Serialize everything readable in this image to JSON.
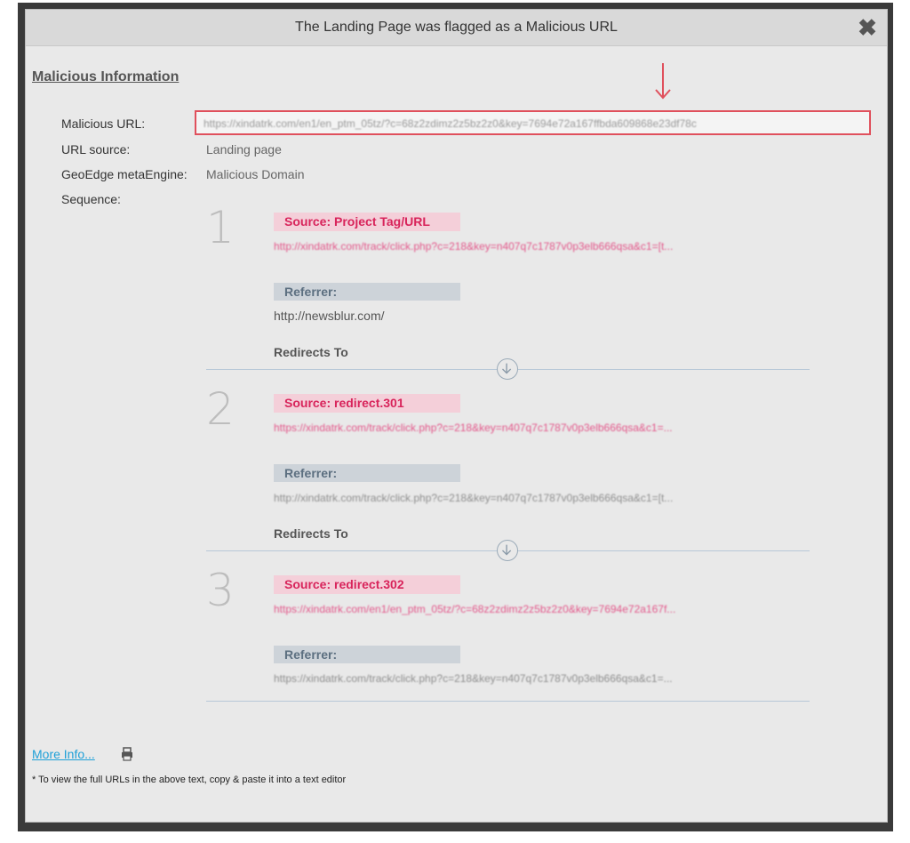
{
  "dialog": {
    "title": "The Landing Page was flagged as a Malicious URL",
    "close_icon": "close-x-icon"
  },
  "section": {
    "title": "Malicious Information"
  },
  "fields": {
    "malicious_url_label": "Malicious URL:",
    "malicious_url_value": "https://xindatrk.com/en1/en_ptm_05tz/?c=68z2zdimz2z5bz2z0&key=7694e72a167ffbda609868e23df78c",
    "url_source_label": "URL source:",
    "url_source_value": "Landing page",
    "engine_label": "GeoEdge metaEngine:",
    "engine_value": "Malicious Domain",
    "sequence_label": "Sequence:"
  },
  "sequence": [
    {
      "number": "1",
      "source_label": "Source: Project Tag/URL",
      "source_url": "http://xindatrk.com/track/click.php?c=218&key=n407q7c1787v0p3elb666qsa&c1=[t...",
      "referrer_label": "Referrer:",
      "referrer_value": "http://newsblur.com/",
      "redirects_label": "Redirects To"
    },
    {
      "number": "2",
      "source_label": "Source: redirect.301",
      "source_url": "https://xindatrk.com/track/click.php?c=218&key=n407q7c1787v0p3elb666qsa&c1=...",
      "referrer_label": "Referrer:",
      "referrer_value": "http://xindatrk.com/track/click.php?c=218&key=n407q7c1787v0p3elb666qsa&c1=[t...",
      "redirects_label": "Redirects To"
    },
    {
      "number": "3",
      "source_label": "Source: redirect.302",
      "source_url": "https://xindatrk.com/en1/en_ptm_05tz/?c=68z2zdimz2z5bz2z0&key=7694e72a167f...",
      "referrer_label": "Referrer:",
      "referrer_value": "https://xindatrk.com/track/click.php?c=218&key=n407q7c1787v0p3elb666qsa&c1=..."
    }
  ],
  "footer": {
    "more_info": "More Info...",
    "note": "* To view the full URLs in the above text, copy & paste it into a text editor"
  },
  "colors": {
    "accent_red": "#e0505c",
    "source_pink": "#d8245b",
    "link_blue": "#1ea0d8"
  }
}
